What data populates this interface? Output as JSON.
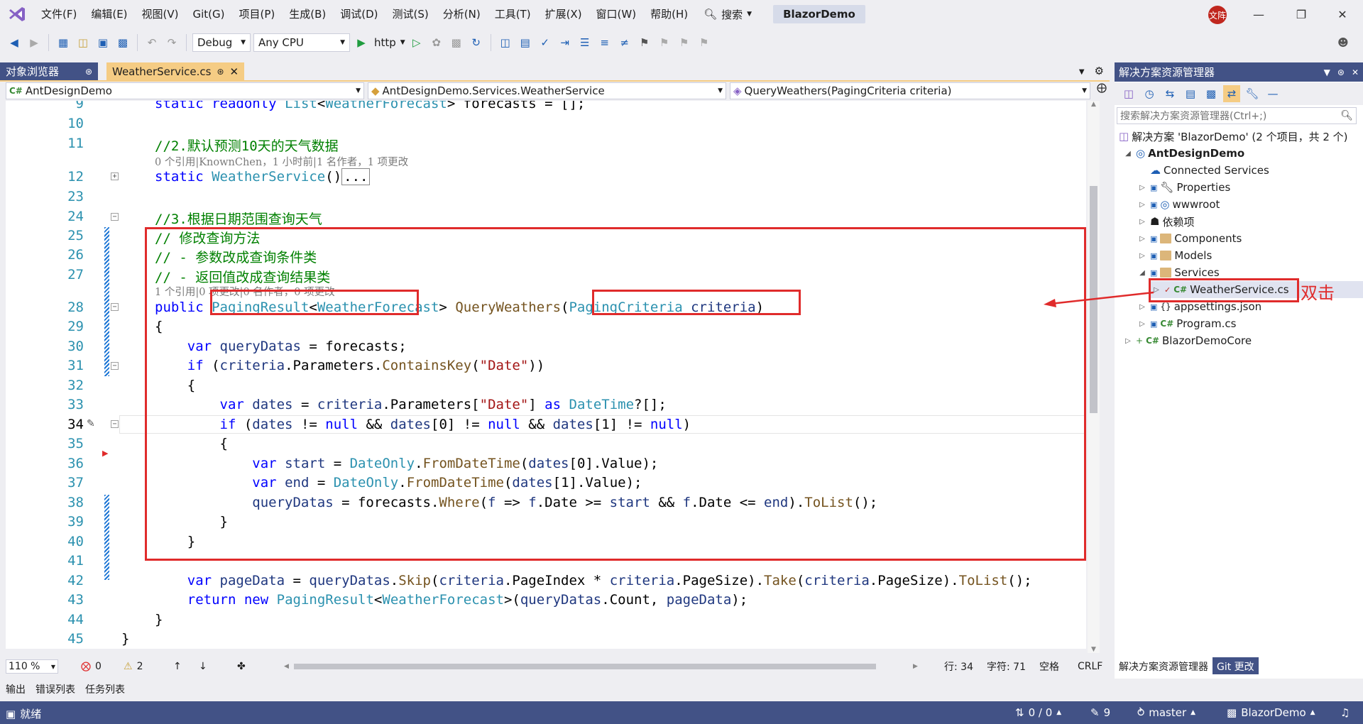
{
  "menu": {
    "items": [
      "文件(F)",
      "编辑(E)",
      "视图(V)",
      "Git(G)",
      "项目(P)",
      "生成(B)",
      "调试(D)",
      "测试(S)",
      "分析(N)",
      "工具(T)",
      "扩展(X)",
      "窗口(W)",
      "帮助(H)"
    ],
    "search_label": "搜索",
    "solution_title": "BlazorDemo",
    "avatar_text": "文阵"
  },
  "toolbar": {
    "config": "Debug",
    "platform": "Any CPU",
    "run_target": "http"
  },
  "tabs": {
    "object_browser": "对象浏览器",
    "active_file": "WeatherService.cs"
  },
  "navbar": {
    "project": "AntDesignDemo",
    "class": "AntDesignDemo.Services.WeatherService",
    "member": "QueryWeathers(PagingCriteria criteria)"
  },
  "code": {
    "line_numbers": [
      "9",
      "10",
      "11",
      "12",
      "23",
      "24",
      "25",
      "26",
      "27",
      "28",
      "29",
      "30",
      "31",
      "32",
      "33",
      "34",
      "35",
      "36",
      "37",
      "38",
      "39",
      "40",
      "41",
      "42",
      "43",
      "44",
      "45"
    ],
    "lens_11": "0 个引用|KnownChen，1 小时前|1 名作者，1 项更改",
    "lens_27": "1 个引用|0 项更改|0 名作者，0 项更改"
  },
  "status": {
    "zoom": "110 %",
    "errors": "0",
    "warnings": "2",
    "line": "行: 34",
    "col": "字符: 71",
    "spaces": "空格",
    "eol": "CRLF",
    "ready": "就绪",
    "git_changes": "0 / 0",
    "edits": "9",
    "branch": "master",
    "repo": "BlazorDemo"
  },
  "output_tabs": [
    "输出",
    "错误列表",
    "任务列表"
  ],
  "solution_explorer": {
    "title": "解决方案资源管理器",
    "search_placeholder": "搜索解决方案资源管理器(Ctrl+;)",
    "solution_node": "解决方案 'BlazorDemo' (2 个项目，共 2 个)",
    "project": "AntDesignDemo",
    "items": [
      "Connected Services",
      "Properties",
      "wwwroot",
      "依赖项",
      "Components",
      "Models",
      "Services"
    ],
    "selected_file": "WeatherService.cs",
    "files_after": [
      "appsettings.json",
      "Program.cs"
    ],
    "project2": "BlazorDemoCore",
    "bottom_tab_1": "解决方案资源管理器",
    "bottom_tab_2": "Git 更改"
  },
  "annotation": "双击",
  "colors": {
    "accent": "#425286",
    "highlight": "#e02b2b",
    "tab_active": "#f5cc84"
  }
}
